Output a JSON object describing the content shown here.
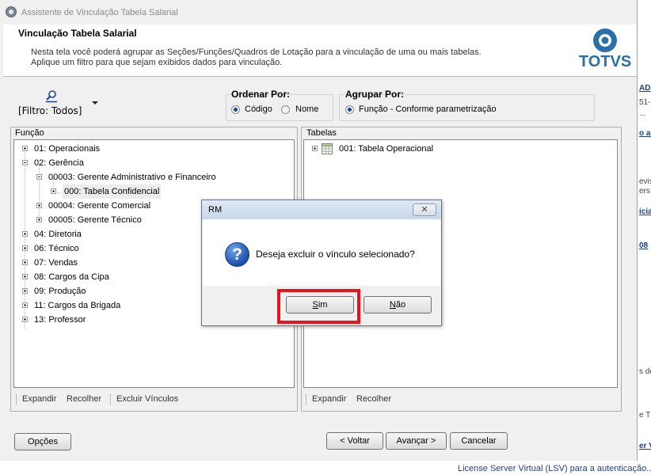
{
  "window": {
    "title": "Assistente de Vinculação Tabela Salarial"
  },
  "header": {
    "title": "Vinculação Tabela Salarial",
    "description_line1": "Nesta tela você poderá agrupar as Seções/Funções/Quadros de Lotação para a vinculação de uma ou mais tabelas.",
    "description_line2": "Aplique um filtro para que sejam exibidos dados para vinculação.",
    "logo_text": "TOTVS"
  },
  "filter": {
    "label": "[Filtro: Todos]",
    "icon": "filter-icon"
  },
  "ordenar": {
    "title": "Ordenar Por:",
    "options": [
      {
        "label": "Código",
        "selected": true
      },
      {
        "label": "Nome",
        "selected": false
      }
    ]
  },
  "agrupar": {
    "title": "Agrupar Por:",
    "options": [
      {
        "label": "Função - Conforme parametrização",
        "selected": true
      }
    ]
  },
  "funcao_panel": {
    "label": "Função",
    "items": [
      {
        "label": "01: Operacionais",
        "expander": "plus"
      },
      {
        "label": "02: Gerência",
        "expander": "minus"
      },
      {
        "label": "00003: Gerente Administrativo e Financeiro",
        "expander": "minus"
      },
      {
        "label": "000: Tabela Confidencial",
        "expander": "plus"
      },
      {
        "label": "00004: Gerente Comercial",
        "expander": "plus"
      },
      {
        "label": "00005: Gerente Técnico",
        "expander": "plus"
      },
      {
        "label": "04: Diretoria",
        "expander": "plus"
      },
      {
        "label": "06: Técnico",
        "expander": "plus"
      },
      {
        "label": "07: Vendas",
        "expander": "plus"
      },
      {
        "label": "08: Cargos da Cipa",
        "expander": "plus"
      },
      {
        "label": "09: Produção",
        "expander": "plus"
      },
      {
        "label": "11: Cargos da Brigada",
        "expander": "plus"
      },
      {
        "label": "13: Professor",
        "expander": "plus"
      }
    ],
    "footer": {
      "expandir": "Expandir",
      "recolher": "Recolher",
      "excluir": "Excluir Vínculos"
    }
  },
  "tabelas_panel": {
    "label": "Tabelas",
    "items": [
      {
        "label": "001: Tabela Operacional",
        "expander": "plus",
        "icon": "table-icon"
      }
    ],
    "footer": {
      "expandir": "Expandir",
      "recolher": "Recolher"
    }
  },
  "buttons": {
    "opcoes": "Opções",
    "voltar": "< Voltar",
    "avancar": "Avançar >",
    "cancelar": "Cancelar"
  },
  "dialog": {
    "title": "RM",
    "close": "✕",
    "message": "Deseja excluir o vínculo selecionado?",
    "yes_first": "S",
    "yes_rest": "im",
    "no_first": "N",
    "no_rest": "ão",
    "highlight_color": "#e8141c"
  },
  "background": {
    "texts": [
      "AD",
      "51-",
      "...",
      "o ac",
      "evis",
      "ers.",
      "icia",
      "08",
      "s de",
      "e T",
      "er V"
    ],
    "bottom_text": "License Server Virtual (LSV) para a autenticação..."
  }
}
